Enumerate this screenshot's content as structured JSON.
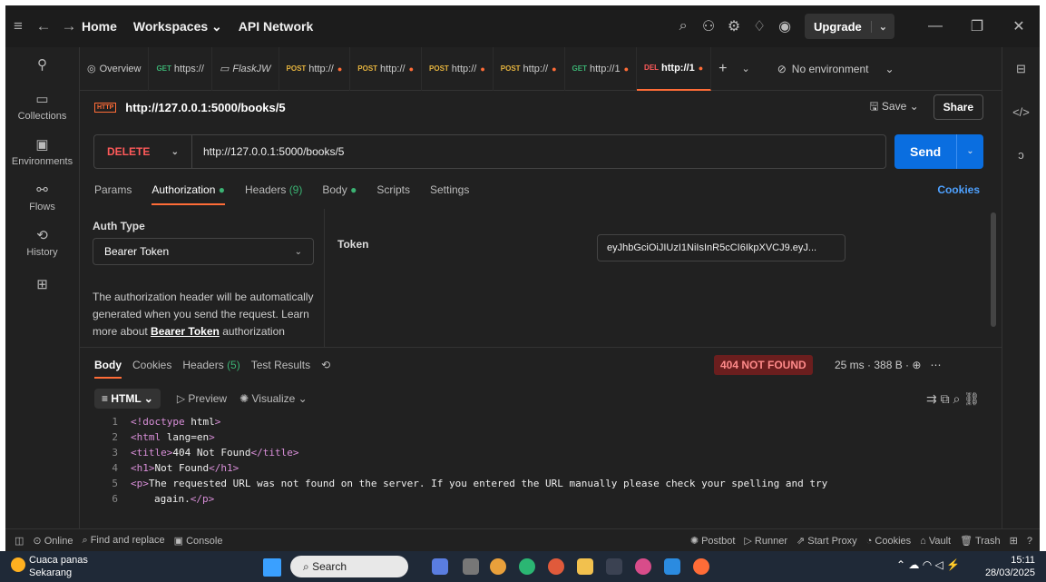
{
  "title_nav": {
    "home": "Home",
    "workspaces": "Workspaces",
    "api_network": "API Network",
    "upgrade": "Upgrade"
  },
  "tabs": [
    {
      "method": "",
      "label": "Overview"
    },
    {
      "method": "GET",
      "label": "https://"
    },
    {
      "method": "",
      "label": "FlaskJW"
    },
    {
      "method": "POST",
      "label": "http://"
    },
    {
      "method": "POST",
      "label": "http://"
    },
    {
      "method": "POST",
      "label": "http://"
    },
    {
      "method": "POST",
      "label": "http://"
    },
    {
      "method": "GET",
      "label": "http://1"
    },
    {
      "method": "DEL",
      "label": "http://1"
    }
  ],
  "environment": "No environment",
  "sidebar": [
    {
      "label": "Collections"
    },
    {
      "label": "Environments"
    },
    {
      "label": "Flows"
    },
    {
      "label": "History"
    }
  ],
  "request": {
    "header_title": "http://127.0.0.1:5000/books/5",
    "method": "DELETE",
    "url": "http://127.0.0.1:5000/books/5",
    "save": "Save",
    "share": "Share",
    "send": "Send"
  },
  "subtabs": {
    "params": "Params",
    "authorization": "Authorization",
    "headers": "Headers",
    "headers_count": "(9)",
    "body": "Body",
    "scripts": "Scripts",
    "settings": "Settings",
    "cookies": "Cookies"
  },
  "auth": {
    "type_label": "Auth Type",
    "type_value": "Bearer Token",
    "desc": "The authorization header will be automatically generated when you send the request. Learn more about",
    "desc_link": "Bearer Token",
    "desc_tail": "authorization",
    "token_label": "Token",
    "token_value": "eyJhbGciOiJIUzI1NiIsInR5cCI6IkpXVCJ9.eyJ..."
  },
  "response": {
    "body": "Body",
    "cookies": "Cookies",
    "headers": "Headers",
    "headers_count": "(5)",
    "test_results": "Test Results",
    "status": "404 NOT FOUND",
    "time": "25 ms",
    "size": "388 B",
    "format": "HTML",
    "preview": "Preview",
    "visualize": "Visualize"
  },
  "code_lines": [
    {
      "n": "1",
      "html": "&lt;!doctype html&gt;"
    },
    {
      "n": "2",
      "html": "&lt;html lang=en&gt;"
    },
    {
      "n": "3",
      "html": "&lt;title&gt;404 Not Found&lt;/title&gt;"
    },
    {
      "n": "4",
      "html": "&lt;h1&gt;Not Found&lt;/h1&gt;"
    },
    {
      "n": "5",
      "html": "&lt;p&gt;The requested URL was not found on the server. If you entered the URL manually please check your spelling and try"
    },
    {
      "n": "6",
      "html": "again.&lt;/p&gt;"
    }
  ],
  "statusbar": {
    "online": "Online",
    "find": "Find and replace",
    "console": "Console",
    "postbot": "Postbot",
    "runner": "Runner",
    "proxy": "Start Proxy",
    "cookies": "Cookies",
    "vault": "Vault",
    "trash": "Trash"
  },
  "taskbar": {
    "weather": "Cuaca panas",
    "weather_sub": "Sekarang",
    "search": "Search",
    "time": "15:11",
    "date": "28/03/2025"
  }
}
